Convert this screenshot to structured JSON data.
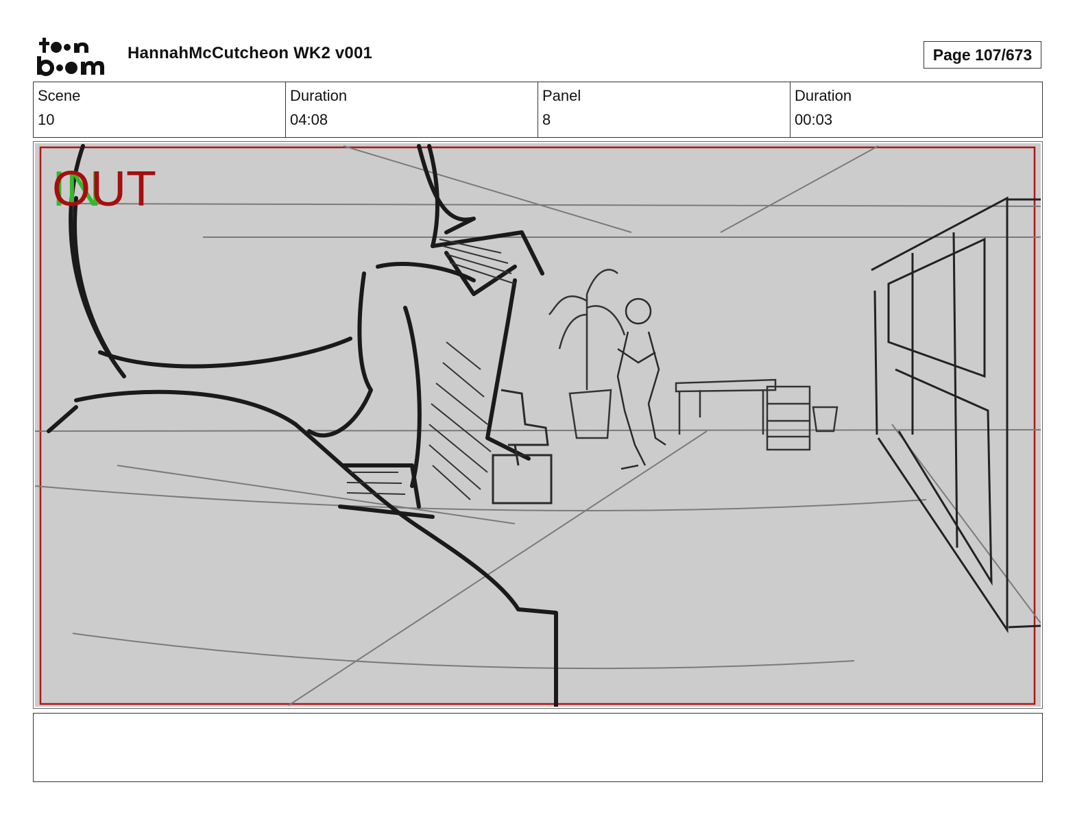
{
  "header": {
    "title": "HannahMcCutcheon WK2 v001",
    "page": "Page 107/673",
    "logo_text": "toon boom"
  },
  "info": {
    "scene_label": "Scene",
    "scene_value": "10",
    "duration_label": "Duration",
    "duration_value": "04:08",
    "panel_label": "Panel",
    "panel_value": "8",
    "panel_duration_label": "Duration",
    "panel_duration_value": "00:03"
  },
  "panel": {
    "in_label": "IN",
    "out_label": "OUT",
    "background_color": "#cccccc",
    "safe_frame_color": "#b01515",
    "in_color": "#35b82a",
    "out_color": "#a50e0e"
  },
  "notes": {
    "text": ""
  }
}
